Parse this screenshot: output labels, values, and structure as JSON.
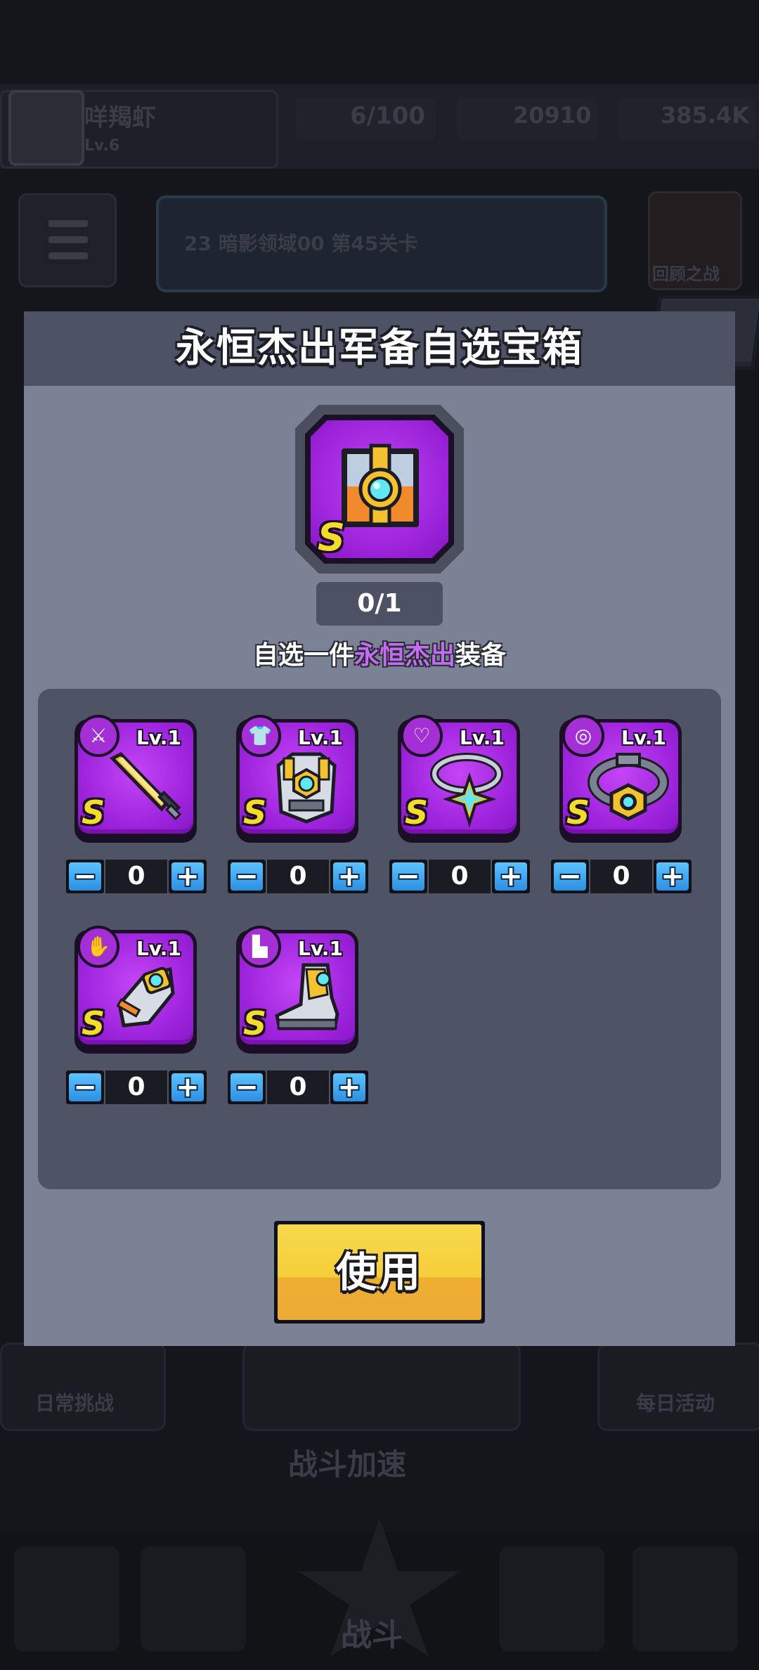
{
  "background": {
    "player_name": "咩羯虾",
    "player_level_label": "Lv.6",
    "energy": "6/100",
    "gems": "20910",
    "gold": "385.4K",
    "event_text": "23 暗影领域00  第45关卡",
    "shield_label": "回顾之战",
    "mode_left": "日常挑战",
    "mode_right": "每日活动",
    "speed_label": "战斗加速",
    "battle_label": "战斗"
  },
  "modal": {
    "title": "永恒杰出军备自选宝箱",
    "close_glyph": "✕",
    "counter": "0/1",
    "subtitle_prefix": "自选一件",
    "subtitle_highlight": "永恒杰出",
    "subtitle_suffix": "装备",
    "use_button": "使用"
  },
  "items": [
    {
      "slot_icon": "weapon-icon",
      "level": "Lv.1",
      "rank": "S",
      "quantity": "0",
      "minus": "−",
      "plus": "+"
    },
    {
      "slot_icon": "armor-icon",
      "level": "Lv.1",
      "rank": "S",
      "quantity": "0",
      "minus": "−",
      "plus": "+"
    },
    {
      "slot_icon": "necklace-icon",
      "level": "Lv.1",
      "rank": "S",
      "quantity": "0",
      "minus": "−",
      "plus": "+"
    },
    {
      "slot_icon": "belt-icon",
      "level": "Lv.1",
      "rank": "S",
      "quantity": "0",
      "minus": "−",
      "plus": "+"
    },
    {
      "slot_icon": "gloves-icon",
      "level": "Lv.1",
      "rank": "S",
      "quantity": "0",
      "minus": "−",
      "plus": "+"
    },
    {
      "slot_icon": "boots-icon",
      "level": "Lv.1",
      "rank": "S",
      "quantity": "0",
      "minus": "−",
      "plus": "+"
    }
  ],
  "colors": {
    "accent_purple": "#9d23dc",
    "highlight_text": "#c36cf2",
    "rank_yellow": "#f5dc2b",
    "button_blue": "#2c8fe3",
    "use_button_yellow": "#f5cf3a"
  }
}
